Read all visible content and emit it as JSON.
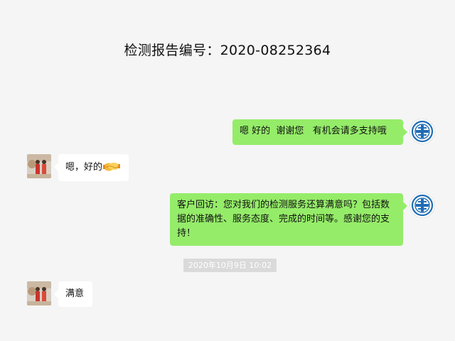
{
  "title": "检测报告编号：2020-08252364",
  "messages": [
    {
      "side": "right",
      "text": "嗯 好的  谢谢您   有机会请多支持哦"
    },
    {
      "side": "left",
      "text": "嗯，好的",
      "emoji": "handshake-emoji"
    },
    {
      "side": "right",
      "text": "客户回访：您对我们的检测服务还算满意吗？包括数据的准确性、服务态度、完成的时间等。感谢您的支持！"
    },
    {
      "side": "left",
      "text": "满意"
    }
  ],
  "timestamp": "2020年10月9日 10:02",
  "colors": {
    "background": "#f5f5f5",
    "sent_bubble": "#95ec69",
    "received_bubble": "#ffffff",
    "logo_blue": "#1f6db5"
  },
  "icons": {
    "company_avatar": "company-logo-icon",
    "customer_avatar": "customer-photo-avatar"
  }
}
